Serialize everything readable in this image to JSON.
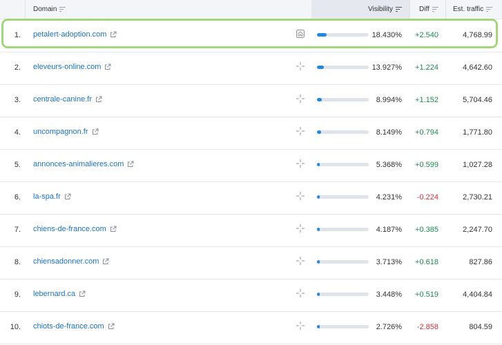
{
  "header": {
    "domain_label": "Domain",
    "visibility_label": "Visibility",
    "diff_label": "Diff",
    "traffic_label": "Est. traffic"
  },
  "colors": {
    "bar_fill": "#1e88e5",
    "bar_track": "#dfe3ea",
    "positive": "#1e8a52",
    "negative": "#d6313d",
    "highlight": "#a3d67a",
    "link": "#1a73c9"
  },
  "rows": [
    {
      "rank": "1.",
      "domain": "petalert-adoption.com",
      "marker": "home-icon",
      "visibility": "18.430%",
      "bar": 0.184,
      "diff": "+2.540",
      "diff_sign": "pos",
      "traffic": "4,768.99"
    },
    {
      "rank": "2.",
      "domain": "eleveurs-online.com",
      "marker": "crosshair-icon",
      "visibility": "13.927%",
      "bar": 0.139,
      "diff": "+1.224",
      "diff_sign": "pos",
      "traffic": "4,642.60"
    },
    {
      "rank": "3.",
      "domain": "centrale-canine.fr",
      "marker": "crosshair-icon",
      "visibility": "8.994%",
      "bar": 0.09,
      "diff": "+1.152",
      "diff_sign": "pos",
      "traffic": "5,704.46"
    },
    {
      "rank": "4.",
      "domain": "uncompagnon.fr",
      "marker": "crosshair-icon",
      "visibility": "8.149%",
      "bar": 0.081,
      "diff": "+0.794",
      "diff_sign": "pos",
      "traffic": "1,771.80"
    },
    {
      "rank": "5.",
      "domain": "annonces-animalieres.com",
      "marker": "crosshair-icon",
      "visibility": "5.368%",
      "bar": 0.054,
      "diff": "+0.599",
      "diff_sign": "pos",
      "traffic": "1,027.28"
    },
    {
      "rank": "6.",
      "domain": "la-spa.fr",
      "marker": "crosshair-icon",
      "visibility": "4.231%",
      "bar": 0.042,
      "diff": "-0.224",
      "diff_sign": "neg",
      "traffic": "2,730.21"
    },
    {
      "rank": "7.",
      "domain": "chiens-de-france.com",
      "marker": "crosshair-icon",
      "visibility": "4.187%",
      "bar": 0.042,
      "diff": "+0.385",
      "diff_sign": "pos",
      "traffic": "2,247.70"
    },
    {
      "rank": "8.",
      "domain": "chiensadonner.com",
      "marker": "crosshair-icon",
      "visibility": "3.713%",
      "bar": 0.037,
      "diff": "+0.618",
      "diff_sign": "pos",
      "traffic": "827.86"
    },
    {
      "rank": "9.",
      "domain": "lebernard.ca",
      "marker": "crosshair-icon",
      "visibility": "3.448%",
      "bar": 0.034,
      "diff": "+0.519",
      "diff_sign": "pos",
      "traffic": "4,404.84"
    },
    {
      "rank": "10.",
      "domain": "chiots-de-france.com",
      "marker": "crosshair-icon",
      "visibility": "2.726%",
      "bar": 0.027,
      "diff": "-2.858",
      "diff_sign": "neg",
      "traffic": "804.59"
    }
  ]
}
